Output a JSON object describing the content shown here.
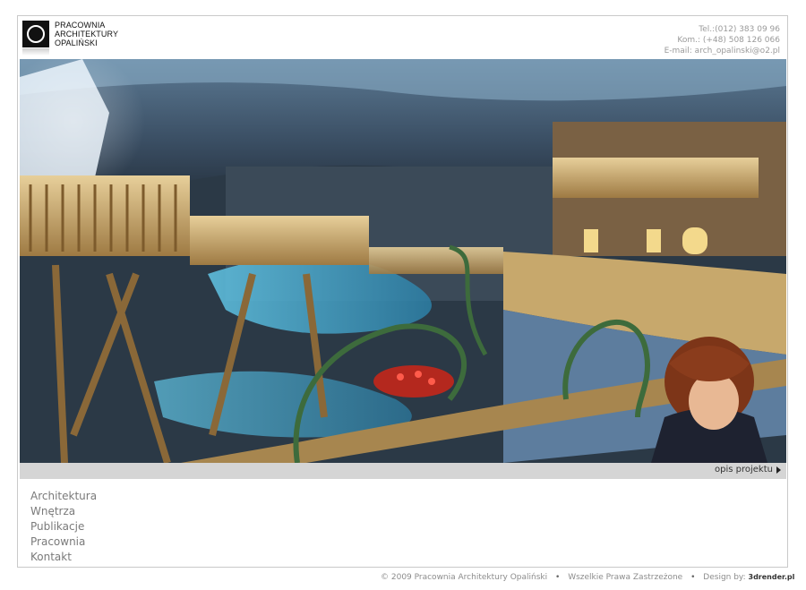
{
  "header": {
    "logo_lines": [
      "PRACOWNIA",
      "ARCHITEKTURY",
      "OPALIŃSKI"
    ],
    "phone": "Tel.:(012) 383 09 96",
    "mobile": "Kom.: (+48) 508 126 066",
    "email": "E-mail: arch_opalinski@o2.pl"
  },
  "hero": {
    "caption_link": "opis projektu"
  },
  "nav": {
    "items": [
      {
        "label": "Architektura"
      },
      {
        "label": "Wnętrza"
      },
      {
        "label": "Publikacje"
      },
      {
        "label": "Pracownia"
      },
      {
        "label": "Kontakt"
      }
    ]
  },
  "footer": {
    "copyright": "© 2009 Pracownia Architektury Opaliński",
    "rights": "Wszelkie Prawa Zastrzeżone",
    "design_by": "Design by:",
    "designer": "3drender.pl"
  }
}
